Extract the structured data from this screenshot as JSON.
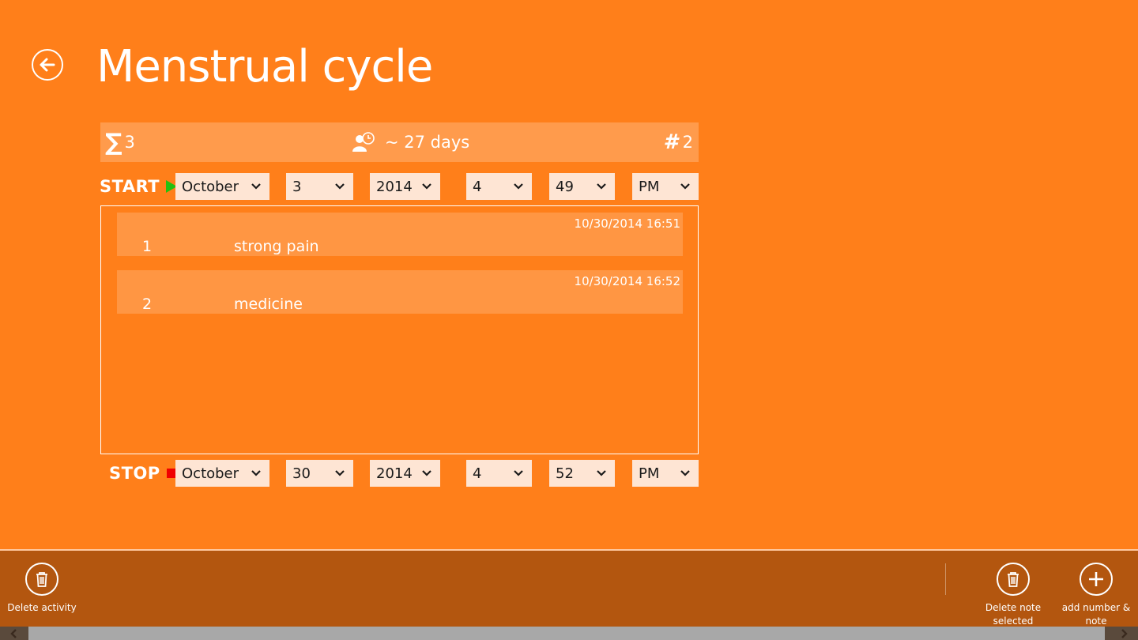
{
  "page": {
    "title": "Menstrual cycle"
  },
  "stats": {
    "sum": "3",
    "cycle": "~ 27 days",
    "count": "2"
  },
  "start": {
    "label": "START",
    "month": "October",
    "day": "3",
    "year": "2014",
    "hour": "4",
    "minute": "49",
    "ampm": "PM"
  },
  "stop": {
    "label": "STOP",
    "month": "October",
    "day": "30",
    "year": "2014",
    "hour": "4",
    "minute": "52",
    "ampm": "PM"
  },
  "notes": [
    {
      "number": "1",
      "text": "strong pain",
      "date": "10/30/2014 16:51"
    },
    {
      "number": "2",
      "text": "medicine",
      "date": "10/30/2014 16:52"
    }
  ],
  "appbar": {
    "delete_activity": "Delete activity",
    "delete_note": "Delete note selected",
    "add_note": "add number & note"
  },
  "colors": {
    "background": "#FF7F1A",
    "appbar": "#B3560F",
    "start_marker": "#22C010",
    "stop_marker": "#F00000"
  },
  "icons": [
    "back-arrow-icon",
    "sigma-icon",
    "cycle-icon",
    "hash-icon",
    "trash-icon",
    "plus-icon",
    "chevron-down-icon"
  ]
}
